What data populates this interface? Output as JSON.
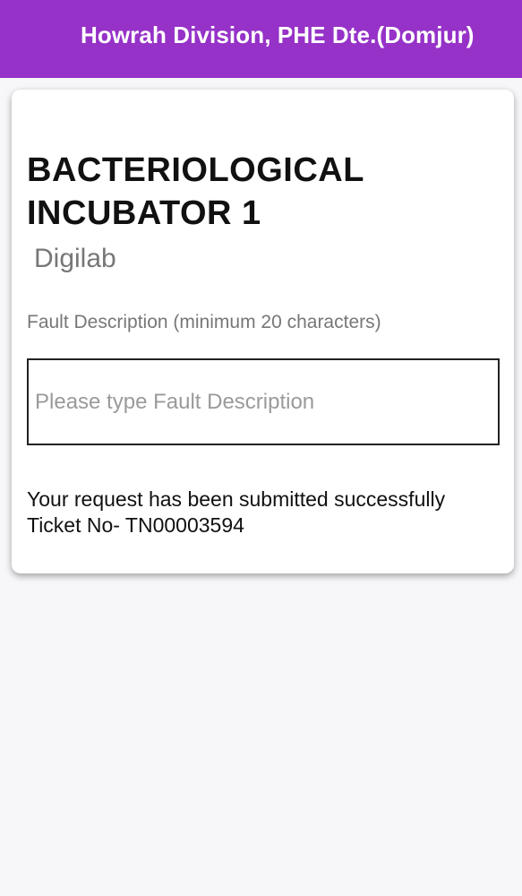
{
  "app_bar": {
    "title": "Howrah Division, PHE Dte.(Domjur)",
    "color": "#9632c8"
  },
  "equipment": {
    "name": "BACTERIOLOGICAL INCUBATOR 1",
    "brand": "Digilab"
  },
  "fault_form": {
    "label": "Fault Description (minimum 20 characters)",
    "value": "",
    "placeholder": "Please type Fault Description"
  },
  "status": {
    "line1": "Your request has been submitted successfully",
    "line2": "Ticket No- TN00003594"
  }
}
